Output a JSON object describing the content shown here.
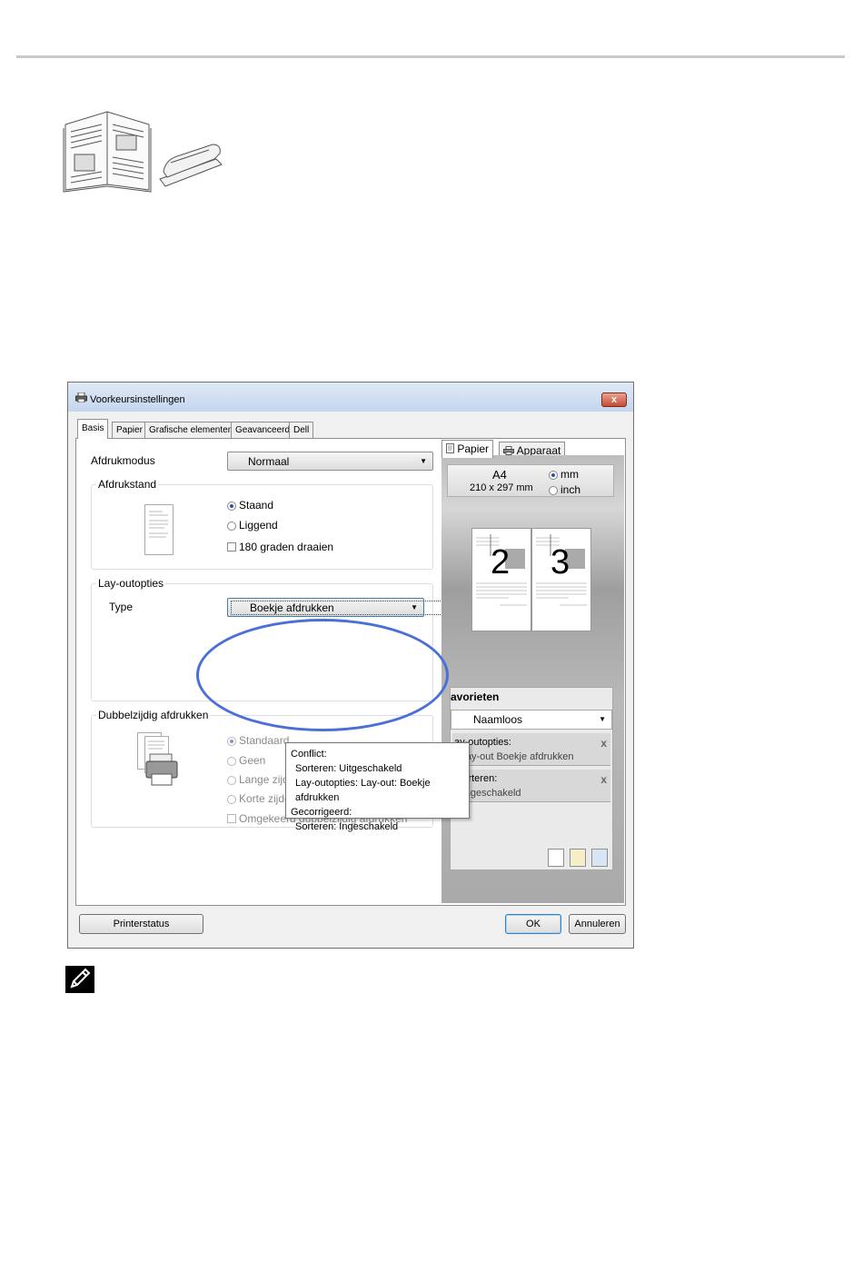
{
  "window": {
    "title": "Voorkeursinstellingen",
    "close_label": "x"
  },
  "tabs": [
    "Basis",
    "Papier",
    "Grafische elementen",
    "Geavanceerd",
    "Dell"
  ],
  "basis": {
    "afdrukmodus_label": "Afdrukmodus",
    "afdrukmodus_value": "Normaal",
    "afdrukstand": {
      "title": "Afdrukstand",
      "staand": "Staand",
      "liggend": "Liggend",
      "rotate": "180 graden draaien"
    },
    "layout": {
      "title": "Lay-outopties",
      "type_label": "Type",
      "type_value": "Boekje afdrukken"
    },
    "duplex": {
      "title": "Dubbelzijdig afdrukken",
      "standaard": "Standaard",
      "geen": "Geen",
      "lange": "Lange zijde",
      "korte": "Korte zijde",
      "omgekeerd": "Omgekeerd dubbelzijdig afdrukken"
    }
  },
  "tooltip": {
    "line1": "Conflict:",
    "line2": "Sorteren: Uitgeschakeld",
    "line3": "Lay-outopties: Lay-out: Boekje afdrukken",
    "line4": "Gecorrigeerd:",
    "line5": "Sorteren: Ingeschakeld"
  },
  "preview": {
    "tab_papier": "Papier",
    "tab_apparaat": "Apparaat",
    "paper_size": "A4",
    "paper_dims": "210 x 297 mm",
    "unit_mm": "mm",
    "unit_inch": "inch",
    "page_left": "2",
    "page_right": "3"
  },
  "favorites": {
    "title": "avorieten",
    "selected": "Naamloos",
    "item1_title": "ay-outopties:",
    "item1_value": "- Lay-out Boekje afdrukken",
    "item2_title": "Sorteren:",
    "item2_value": "- Ingeschakeld",
    "remove_label": "x"
  },
  "buttons": {
    "printer_status": "Printerstatus",
    "ok": "OK",
    "cancel": "Annuleren"
  }
}
